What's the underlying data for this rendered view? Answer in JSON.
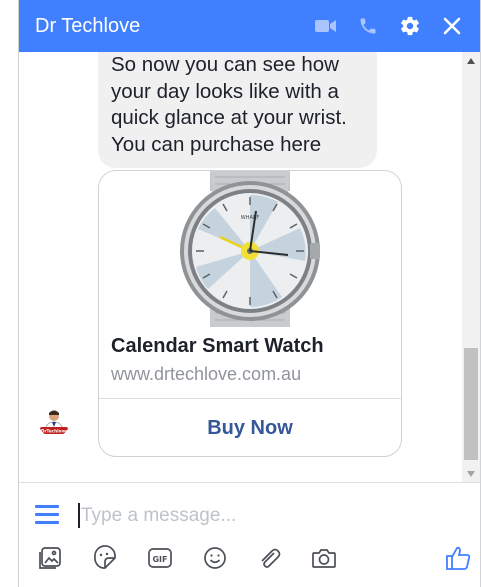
{
  "header": {
    "title": "Dr Techlove"
  },
  "icons": {
    "video": "video-camera-icon",
    "call": "phone-icon",
    "settings": "gear-icon",
    "close": "close-icon"
  },
  "messages": {
    "bot_text": "So now you can see how your day looks like with a quick glance at your wrist. You can purchase here",
    "card": {
      "title": "Calendar Smart Watch",
      "subtitle": "www.drtechlove.com.au",
      "button_label": "Buy Now",
      "image": "smart-watch-image",
      "watch_brand": "WHARF"
    }
  },
  "composer": {
    "placeholder": "Type a message...",
    "tools": [
      "photo-icon",
      "sticker-icon",
      "gif-icon",
      "emoji-icon",
      "attachment-icon",
      "camera-icon",
      "thumbs-up-icon"
    ],
    "gif_label": "GIF"
  },
  "colors": {
    "brand": "#4080ff",
    "button_text": "#365899",
    "bubble": "#f1f0f0"
  }
}
